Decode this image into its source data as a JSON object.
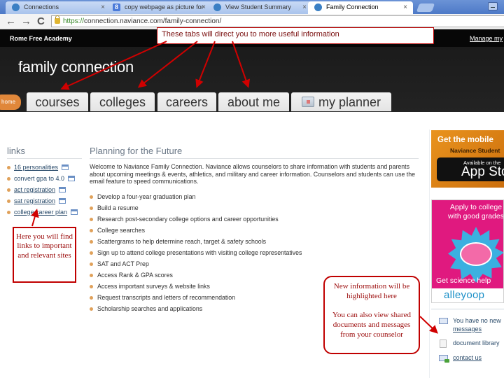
{
  "browser": {
    "tabs": [
      {
        "label": "Connections",
        "icon": "naviance-icon",
        "active": false
      },
      {
        "label": "copy webpage as picture for",
        "icon": "google-icon",
        "active": false
      },
      {
        "label": "View Student Summary",
        "icon": "naviance-icon",
        "active": false
      },
      {
        "label": "Family Connection",
        "icon": "naviance-icon",
        "active": true
      }
    ],
    "close_glyph": "×",
    "back_glyph": "←",
    "forward_glyph": "→",
    "reload_glyph": "C",
    "google_glyph": "8",
    "url_scheme": "https://",
    "url_rest": "connection.naviance.com/family-connection/"
  },
  "site": {
    "school_name": "Rome Free Academy",
    "manage_link": "Manage my",
    "brand": "family connection",
    "home_label": "home",
    "nav_tabs": [
      {
        "label": "courses"
      },
      {
        "label": "colleges"
      },
      {
        "label": "careers"
      },
      {
        "label": "about me"
      },
      {
        "label": "my planner",
        "icon": "planner-icon"
      }
    ]
  },
  "links": {
    "heading": "links",
    "items": [
      "16 personalities",
      "convert gpa to 4.0",
      "act registration",
      "sat registration",
      "college career plan"
    ]
  },
  "planning": {
    "heading": "Planning for the Future",
    "intro": "Welcome to Naviance Family Connection. Naviance allows counselors to share information with students and parents about upcoming meetings & events, athletics, and military and career information. Counselors and students can use the email feature to speed communications.",
    "items": [
      "Develop a four-year graduation plan",
      "Build a resume",
      "Research post-secondary college options and career opportunities",
      "College searches",
      "Scattergrams to help determine reach, target & safety schools",
      "Sign up to attend college presentations with visiting college representatives",
      "SAT and ACT Prep",
      "Access Rank & GPA scores",
      "Access important surveys & website links",
      "Request transcripts and letters of recommendation",
      "Scholarship searches and applications"
    ]
  },
  "sidebar": {
    "ad_mobile": {
      "line1": "Get the mobile",
      "line2": "Naviance Student",
      "store_small": "Available on the",
      "store_big": "App Store",
      "apple_glyph": ""
    },
    "ad_alleyoop": {
      "line1": "Apply to college",
      "line2": "with good grades",
      "line3": "Get science help",
      "brand": "alleyoop"
    },
    "messages_prefix": "You have no new",
    "messages_link": "messages",
    "document_library": "document library",
    "contact_us": "contact us"
  },
  "annotations": {
    "tabs_note": "These tabs will direct you to more useful information",
    "links_note": "Here you will find links to important and relevant sites",
    "info_note_1": "New information will be highlighted here",
    "info_note_2": "You can also view shared documents and messages from your counselor",
    "color": "#c00000"
  }
}
